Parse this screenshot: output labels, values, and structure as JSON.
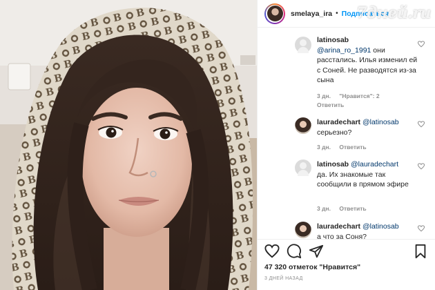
{
  "header": {
    "username": "smelaya_ira",
    "dot": "•",
    "follow_label": "Подписаться"
  },
  "watermark": "7дней.ru",
  "icons": {
    "like": "heart-icon",
    "comment": "comment-icon",
    "share": "send-icon",
    "save": "bookmark-icon",
    "comment_like": "small-heart-icon"
  },
  "colors": {
    "follow": "#0095f6",
    "text": "#262626",
    "muted": "#8e8e8e",
    "mention": "#00376b"
  },
  "comments": [
    {
      "username": "latinosab",
      "mention": "@arina_ro_1991",
      "text": " они расстались. Илья изменил ей с Соней. Не разводятся из-за сына",
      "time": "3 дн.",
      "likes": "\"Нравится\": 2",
      "reply": "Ответить",
      "avatar": "blank"
    },
    {
      "username": "lauradechart",
      "mention": "@latinosab",
      "text": " серьезно?",
      "time": "3 дн.",
      "likes": "",
      "reply": "Ответить",
      "avatar": "photo"
    },
    {
      "username": "latinosab",
      "mention": "@lauradechart",
      "text": " да. Их знакомые так сообщили в прямом эфире",
      "time": "3 дн.",
      "likes": "",
      "reply": "Ответить",
      "avatar": "blank"
    },
    {
      "username": "lauradechart",
      "mention": "@latinosab",
      "text": " а что за Соня?",
      "time": "",
      "likes": "",
      "reply": "",
      "avatar": "photo"
    }
  ],
  "likes_count": "47 320 отметок \"Нравится\"",
  "posted": "3 ДНЕЙ НАЗАД"
}
